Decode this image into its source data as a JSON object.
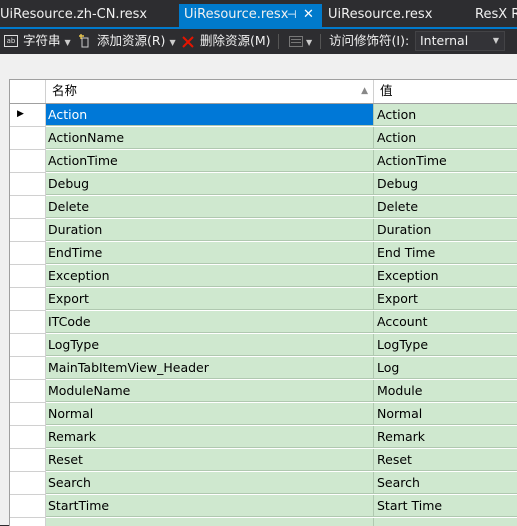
{
  "tabs": [
    {
      "label": "UiResource.zh-CN.resx"
    },
    {
      "label": "UiResource.resx",
      "active": true
    },
    {
      "label": "UiResource.resx"
    },
    {
      "label": "ResX R"
    }
  ],
  "toolbar": {
    "strings_label": "字符串",
    "add_resource_label": "添加资源(R)",
    "remove_resource_label": "删除资源(M)",
    "access_modifier_label": "访问修饰符(I):",
    "access_modifier_value": "Internal"
  },
  "grid": {
    "columns": [
      "名称",
      "值"
    ],
    "rows": [
      {
        "name": "Action",
        "value": "Action"
      },
      {
        "name": "ActionName",
        "value": "Action"
      },
      {
        "name": "ActionTime",
        "value": "ActionTime"
      },
      {
        "name": "Debug",
        "value": "Debug"
      },
      {
        "name": "Delete",
        "value": "Delete"
      },
      {
        "name": "Duration",
        "value": "Duration"
      },
      {
        "name": "EndTime",
        "value": "End Time"
      },
      {
        "name": "Exception",
        "value": "Exception"
      },
      {
        "name": "Export",
        "value": "Export"
      },
      {
        "name": "ITCode",
        "value": "Account"
      },
      {
        "name": "LogType",
        "value": "LogType"
      },
      {
        "name": "MainTabItemView_Header",
        "value": "Log"
      },
      {
        "name": "ModuleName",
        "value": "Module"
      },
      {
        "name": "Normal",
        "value": "Normal"
      },
      {
        "name": "Remark",
        "value": "Remark"
      },
      {
        "name": "Reset",
        "value": "Reset"
      },
      {
        "name": "Search",
        "value": "Search"
      },
      {
        "name": "StartTime",
        "value": "Start Time"
      },
      {
        "name": "",
        "value": ""
      }
    ]
  },
  "colors": {
    "accent": "#007acc",
    "row_bg": "#cfe8cf",
    "selected": "#0078d7"
  }
}
